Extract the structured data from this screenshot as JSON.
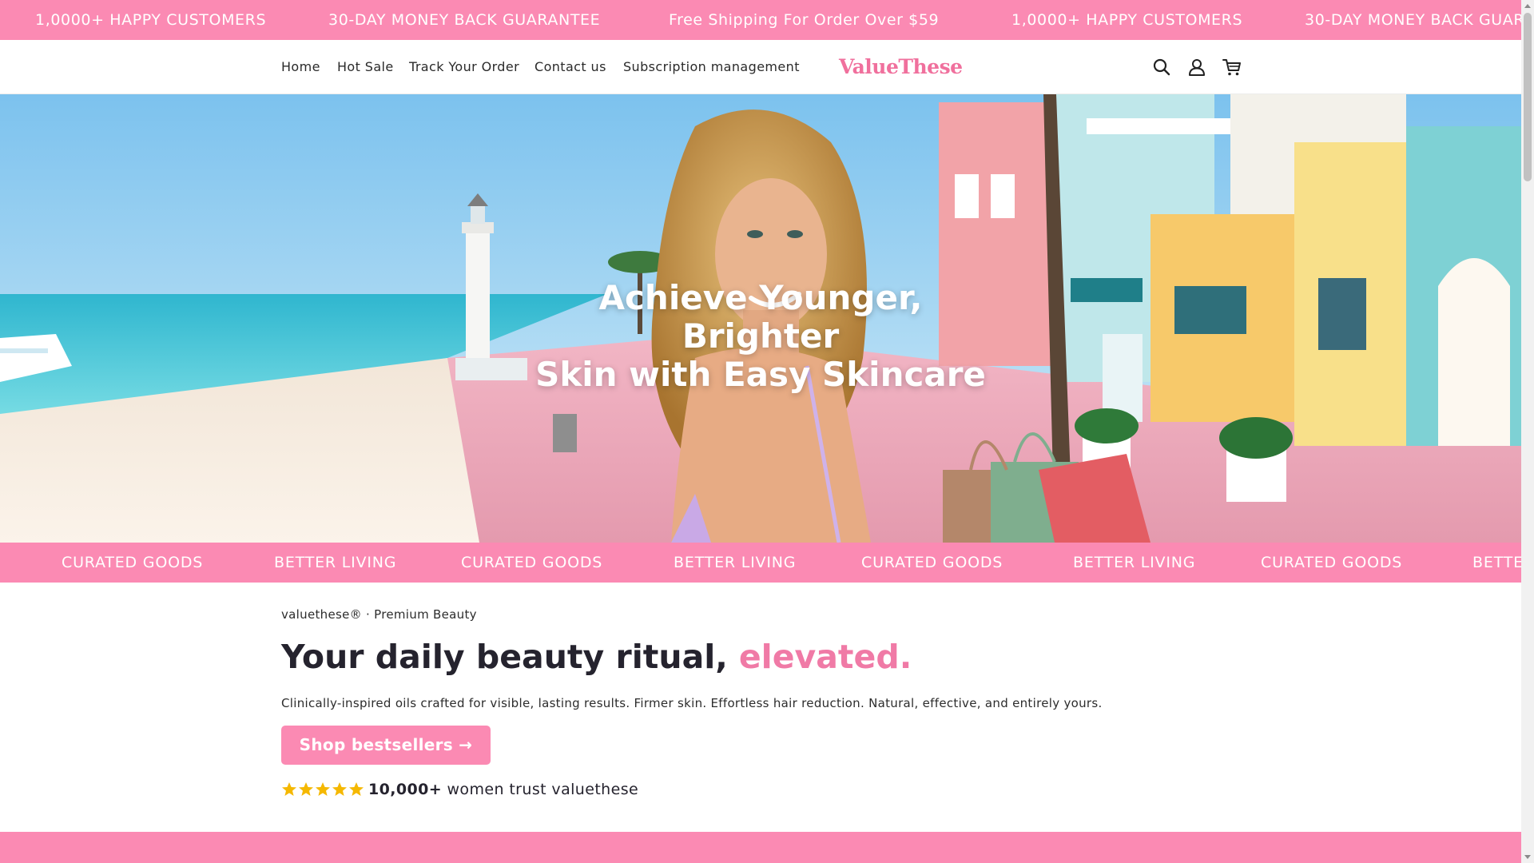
{
  "announcement": {
    "items": [
      "1,0000+ HAPPY CUSTOMERS",
      "30-DAY MONEY BACK GUARANTEE",
      "Free Shipping For Order Over $59",
      "1,0000+ HAPPY CUSTOMERS",
      "30-DAY MONEY BACK GUARA"
    ]
  },
  "header": {
    "nav": [
      "Home",
      "Hot Sale",
      "Track Your Order",
      "Contact us",
      "Subscription management"
    ],
    "logo": "ValueThese",
    "icons": [
      "search-icon",
      "account-icon",
      "cart-icon"
    ]
  },
  "hero": {
    "title_line1": "Achieve Younger, Brighter",
    "title_line2": "Skin with Easy Skincare"
  },
  "marquee": {
    "items": [
      "CURATED GOODS",
      "BETTER LIVING",
      "CURATED GOODS",
      "BETTER LIVING",
      "CURATED GOODS",
      "BETTER LIVING",
      "CURATED GOODS",
      "BETTE"
    ]
  },
  "intro": {
    "eyebrow": "valuethese® · Premium Beauty",
    "headline_main": "Your daily beauty ritual,",
    "headline_accent": "elevated.",
    "description": "Clinically-inspired oils crafted for visible, lasting results. Firmer skin. Effortless hair reduction. Natural, effective, and entirely yours.",
    "cta_label": "Shop bestsellers →",
    "rating_stars": 5,
    "trust_count": "10,000+",
    "trust_text": " women trust valuethese"
  },
  "colors": {
    "brand_pink": "#fb8ab3",
    "accent_pink": "#f07aa6",
    "text_dark": "#25232e",
    "star_gold": "#f5b800"
  }
}
